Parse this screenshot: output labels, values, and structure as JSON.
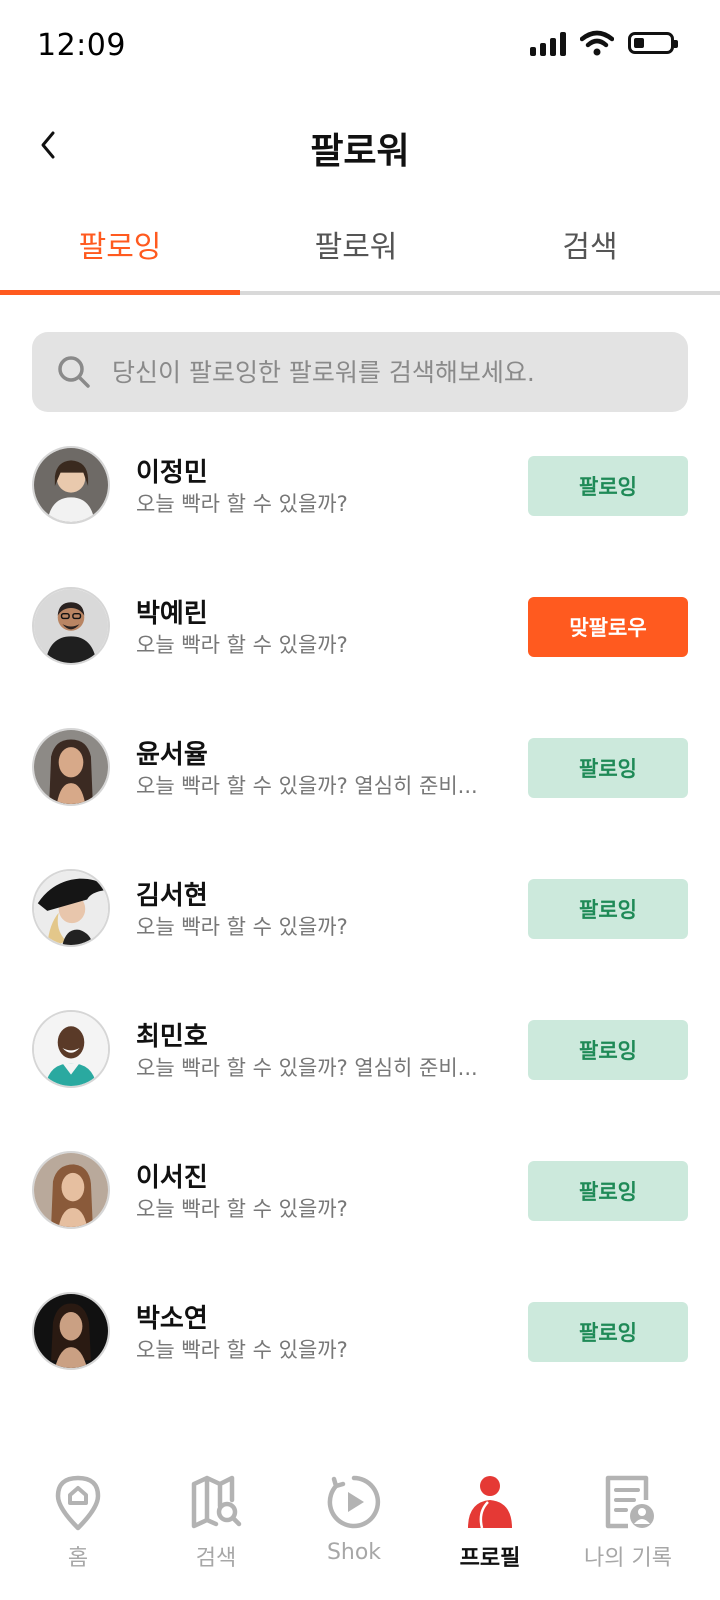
{
  "status_bar": {
    "time": "12:09",
    "battery_level": 0.3
  },
  "header": {
    "title": "팔로워"
  },
  "tabs": [
    {
      "label": "팔로잉",
      "active": true
    },
    {
      "label": "팔로워",
      "active": false
    },
    {
      "label": "검색",
      "active": false
    }
  ],
  "search": {
    "placeholder": "당신이 팔로잉한 팔로워를 검색해보세요.",
    "value": ""
  },
  "users": [
    {
      "name": "이정민",
      "status": "오늘 빡라 할 수 있을까?",
      "button": "팔로잉",
      "button_type": "following"
    },
    {
      "name": "박예린",
      "status": "오늘 빡라 할 수 있을까?",
      "button": "맞팔로우",
      "button_type": "followback"
    },
    {
      "name": "윤서율",
      "status": "오늘 빡라 할 수 있을까? 열심히 준비...",
      "button": "팔로잉",
      "button_type": "following"
    },
    {
      "name": "김서현",
      "status": "오늘 빡라 할 수 있을까?",
      "button": "팔로잉",
      "button_type": "following"
    },
    {
      "name": "최민호",
      "status": "오늘 빡라 할 수 있을까? 열심히 준비...",
      "button": "팔로잉",
      "button_type": "following"
    },
    {
      "name": "이서진",
      "status": "오늘 빡라 할 수 있을까?",
      "button": "팔로잉",
      "button_type": "following"
    },
    {
      "name": "박소연",
      "status": "오늘 빡라 할 수 있을까?",
      "button": "팔로잉",
      "button_type": "following"
    }
  ],
  "bottom_nav": [
    {
      "label": "홈",
      "icon": "home-pin-icon",
      "active": false
    },
    {
      "label": "검색",
      "icon": "map-search-icon",
      "active": false
    },
    {
      "label": "Shok",
      "icon": "play-circle-icon",
      "active": false
    },
    {
      "label": "프로필",
      "icon": "profile-icon",
      "active": true
    },
    {
      "label": "나의 기록",
      "icon": "record-icon",
      "active": false
    }
  ],
  "colors": {
    "accent": "#FF5A1F",
    "following_bg": "#cce9dc",
    "following_text": "#1f8a57",
    "nav_active": "#E53935",
    "nav_inactive": "#b3b3b3"
  }
}
